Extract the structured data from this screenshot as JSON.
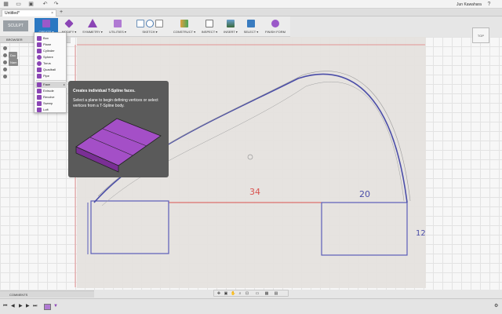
{
  "app": {
    "document_title": "Untitled*",
    "user_name": "Jun Kawahara",
    "close_glyph": "×",
    "new_tab_glyph": "+"
  },
  "toolbar": {
    "workspace": "SCULPT",
    "groups": [
      {
        "label": "CREATE ▾"
      },
      {
        "label": "MODIFY ▾"
      },
      {
        "label": "SYMMETRY ▾"
      },
      {
        "label": "UTILITIES ▾"
      },
      {
        "label": "SKETCH ▾"
      },
      {
        "label": "CONSTRUCT ▾"
      },
      {
        "label": "INSPECT ▾"
      },
      {
        "label": "INSERT ▾"
      },
      {
        "label": "SELECT ▾"
      },
      {
        "label": "FINISH FORM"
      }
    ]
  },
  "browser": {
    "title": "BROWSER",
    "nodes": [
      "",
      "Doc",
      "Nam",
      "",
      ""
    ]
  },
  "create_menu": {
    "items": [
      "Box",
      "Plane",
      "Cylinder",
      "Sphere",
      "Torus",
      "Quadball",
      "Pipe",
      "Face",
      "Extrude",
      "Revolve",
      "Sweep",
      "Loft"
    ],
    "selected_index": 7,
    "selected_extra": "▸"
  },
  "tooltip": {
    "title": "Creates individual T-Spline faces.",
    "body": "Select a plane to begin defining vertices or select vertices from a T-Spline body."
  },
  "sketch_annotations": {
    "width_a": "34",
    "width_b": "20",
    "height": "12"
  },
  "viewcube": {
    "face_label": "TOP"
  },
  "comments": {
    "title": "COMMENTS"
  },
  "colors": {
    "accent": "#2b78c2",
    "tspline": "#8b45b5",
    "sketch_line": "#5a5db8",
    "construction": "#d9534f"
  },
  "icons": [
    "grid-icon",
    "file-icon",
    "save-icon",
    "undo-icon",
    "redo-icon",
    "help-icon",
    "settings-icon"
  ]
}
